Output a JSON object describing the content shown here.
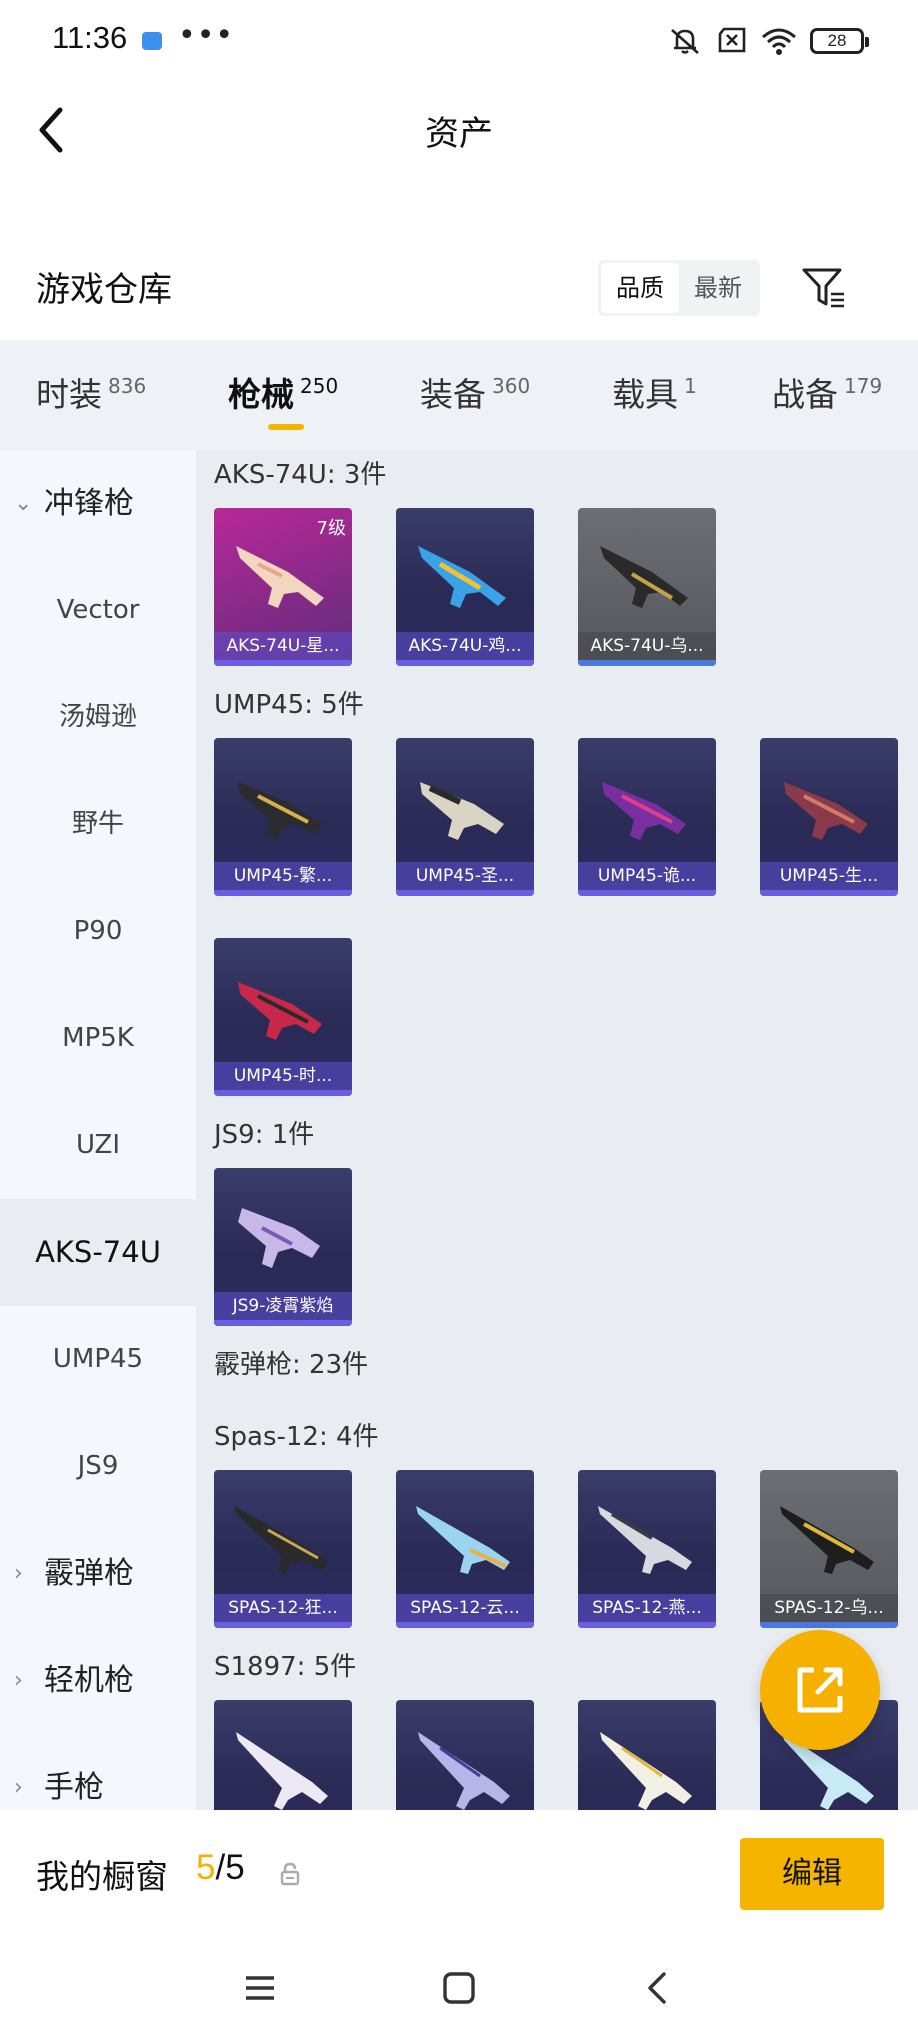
{
  "status_bar": {
    "time": "11:36",
    "more": "•••",
    "battery": "28"
  },
  "header": {
    "title": "资产"
  },
  "section": {
    "title": "游戏仓库",
    "sort_options": [
      "品质",
      "最新"
    ],
    "sort_selected": "品质"
  },
  "tabs": [
    {
      "label": "时装",
      "count": "836"
    },
    {
      "label": "枪械",
      "count": "250"
    },
    {
      "label": "装备",
      "count": "360"
    },
    {
      "label": "载具",
      "count": "1"
    },
    {
      "label": "战备",
      "count": "179"
    }
  ],
  "active_tab": "枪械",
  "sidenav": {
    "categories": {
      "smg": "冲锋枪",
      "shotgun": "霰弹枪",
      "lmg": "轻机枪",
      "pistol": "手枪"
    },
    "items": [
      "Vector",
      "汤姆逊",
      "野牛",
      "P90",
      "MP5K",
      "UZI",
      "AKS-74U",
      "UMP45",
      "JS9"
    ],
    "selected": "AKS-74U"
  },
  "groups": {
    "aks": {
      "title": "AKS-74U: 3件",
      "items": [
        {
          "name": "AKS-74U-星...",
          "level": "7级"
        },
        {
          "name": "AKS-74U-鸡..."
        },
        {
          "name": "AKS-74U-乌..."
        }
      ]
    },
    "ump": {
      "title": "UMP45: 5件",
      "items": [
        {
          "name": "UMP45-繁..."
        },
        {
          "name": "UMP45-圣..."
        },
        {
          "name": "UMP45-诡..."
        },
        {
          "name": "UMP45-生..."
        },
        {
          "name": "UMP45-时..."
        }
      ]
    },
    "js9": {
      "title": "JS9: 1件",
      "items": [
        {
          "name": "JS9-凌霄紫焰"
        }
      ]
    },
    "shotgun": {
      "title": "霰弹枪: 23件"
    },
    "spas": {
      "title": "Spas-12: 4件",
      "items": [
        {
          "name": "SPAS-12-狂..."
        },
        {
          "name": "SPAS-12-云..."
        },
        {
          "name": "SPAS-12-燕..."
        },
        {
          "name": "SPAS-12-乌..."
        }
      ]
    },
    "s1897": {
      "title": "S1897: 5件"
    }
  },
  "showcase": {
    "label": "我的橱窗",
    "current": "5",
    "total": "/5",
    "edit_label": "编辑"
  },
  "colors": {
    "accent": "#f5b400",
    "card_bg": "#2a2a55",
    "card_pink": "#b8289a",
    "card_gray": "#5f6267"
  }
}
